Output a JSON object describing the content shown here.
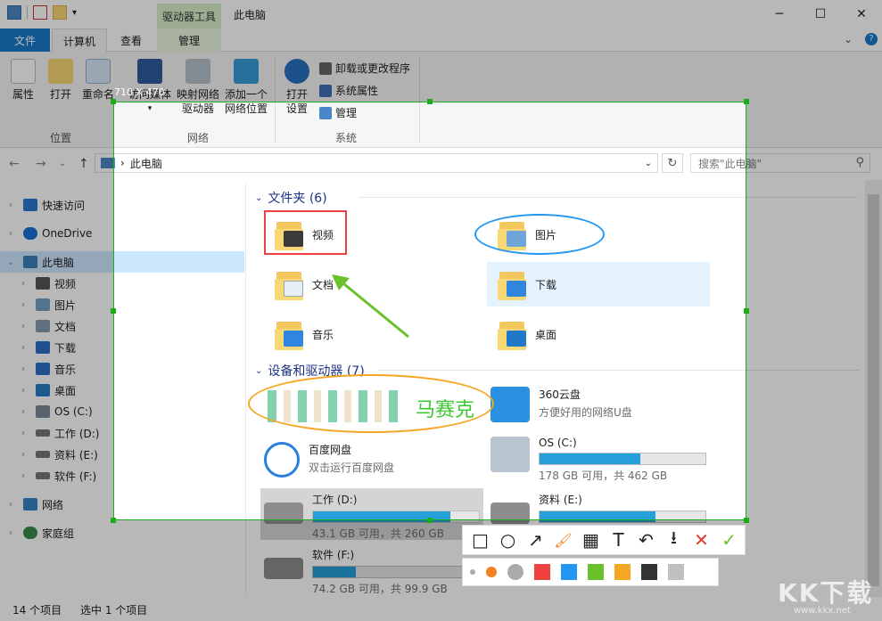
{
  "titlebar": {
    "context_tab": "驱动器工具",
    "title": "此电脑",
    "minimize": "─",
    "maximize": "☐",
    "close": "✕"
  },
  "tabs": {
    "file": "文件",
    "computer": "计算机",
    "view": "查看",
    "manage": "管理",
    "collapse": "⌄",
    "help": "?"
  },
  "ribbon": {
    "properties": "属性",
    "open": "打开",
    "rename": "重命名",
    "access_media": "访问媒体",
    "map_drive_1": "映射网络",
    "map_drive_2": "驱动器",
    "add_location_1": "添加一个",
    "add_location_2": "网络位置",
    "open_settings_1": "打开",
    "open_settings_2": "设置",
    "uninstall": "卸载或更改程序",
    "system_properties": "系统属性",
    "manage": "管理",
    "group_location": "位置",
    "group_network": "网络",
    "group_system": "系统"
  },
  "navbar": {
    "back": "←",
    "forward": "→",
    "recent": "⌄",
    "up": "↑",
    "path": "此电脑",
    "path_sep": "›",
    "refresh": "↻",
    "search_placeholder": "搜索\"此电脑\"",
    "search_glyph": "⚲"
  },
  "sidebar": {
    "items": [
      {
        "label": "快速访问",
        "color": "#2b78d0"
      },
      {
        "label": "OneDrive",
        "color": "#1a6fd1"
      },
      {
        "label": "此电脑",
        "color": "#3d7fb8"
      },
      {
        "label": "视频",
        "color": "#555555"
      },
      {
        "label": "图片",
        "color": "#6fa0c8"
      },
      {
        "label": "文档",
        "color": "#8a9bb0"
      },
      {
        "label": "下载",
        "color": "#2e6fc4"
      },
      {
        "label": "音乐",
        "color": "#2e6fc4"
      },
      {
        "label": "桌面",
        "color": "#2a7cc8"
      },
      {
        "label": "OS (C:)",
        "color": "#7a8a99"
      },
      {
        "label": "工作 (D:)",
        "color": "#777777"
      },
      {
        "label": "资料 (E:)",
        "color": "#777777"
      },
      {
        "label": "软件 (F:)",
        "color": "#777777"
      },
      {
        "label": "网络",
        "color": "#3a82c4"
      },
      {
        "label": "家庭组",
        "color": "#3a8a4a"
      }
    ]
  },
  "content": {
    "folders_header": "文件夹 (6)",
    "drives_header": "设备和驱动器 (7)",
    "folders": [
      {
        "name": "视频",
        "badge": "#3b3b3b"
      },
      {
        "name": "图片",
        "badge": "#6fa5d8"
      },
      {
        "name": "文档",
        "badge": "#e8eef5"
      },
      {
        "name": "下载",
        "badge": "#2e86de"
      },
      {
        "name": "音乐",
        "badge": "#2e86de"
      },
      {
        "name": "桌面",
        "badge": "#1f78c8"
      }
    ],
    "cloud": {
      "name": "360云盘",
      "desc": "方便好用的网络U盘"
    },
    "baidu": {
      "name": "百度网盘",
      "desc": "双击运行百度网盘"
    },
    "drives": [
      {
        "name": "OS (C:)",
        "free": "178 GB 可用，共 462 GB",
        "used_fraction": 0.61
      },
      {
        "name": "工作 (D:)",
        "free": "43.1 GB 可用，共 260 GB",
        "used_fraction": 0.83
      },
      {
        "name": "资料 (E:)",
        "free": "",
        "used_fraction": 0.7
      },
      {
        "name": "软件 (F:)",
        "free": "74.2 GB 可用，共 99.9 GB",
        "used_fraction": 0.26
      }
    ]
  },
  "status": {
    "count": "14 个项目",
    "selected": "选中 1 个项目"
  },
  "screenshot_tool": {
    "size_label": "710 X 470",
    "mosaic_caption": "马赛克",
    "tools": {
      "rect": "□",
      "ellipse": "○",
      "arrow": "↗",
      "brush": "🖌",
      "mosaic": "▦",
      "text": "T",
      "undo": "↶",
      "save": "⭳",
      "cancel": "✕",
      "confirm": "✓"
    },
    "colors": [
      "#f5821f",
      "#bdbdbd",
      "#f04040",
      "#2196f3",
      "#6ac12b",
      "#f5a623",
      "#333333",
      "#c0c0c0"
    ]
  },
  "watermark": {
    "main": "KK下载",
    "sub": "www.kkx.net"
  }
}
